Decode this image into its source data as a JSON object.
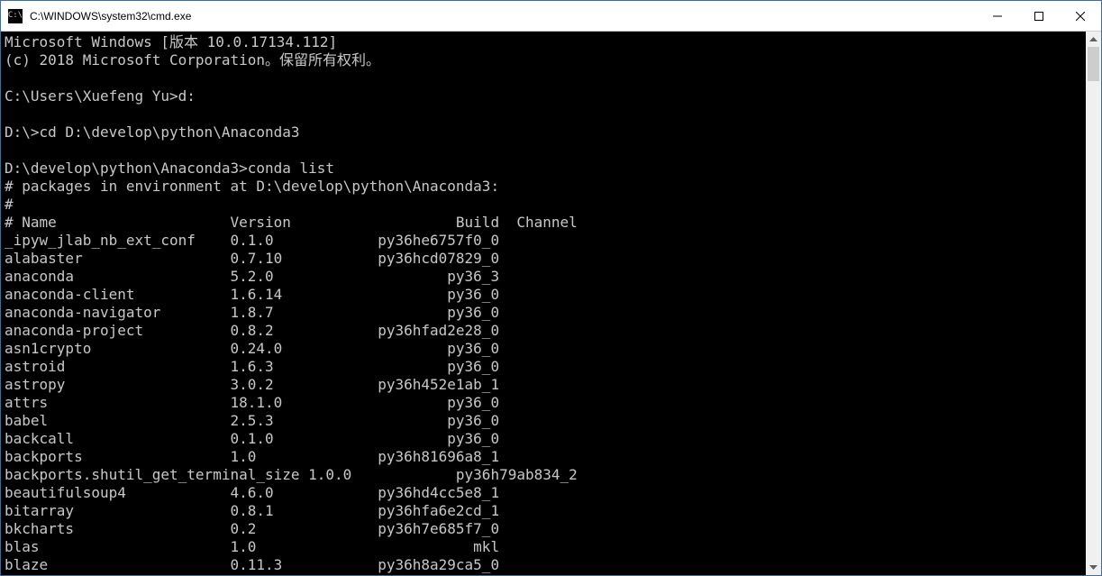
{
  "window": {
    "title": "C:\\WINDOWS\\system32\\cmd.exe"
  },
  "terminal": {
    "line0": "Microsoft Windows [版本 10.0.17134.112]",
    "line1": "(c) 2018 Microsoft Corporation。保留所有权利。",
    "blank": "",
    "prompt1": "C:\\Users\\Xuefeng Yu>d:",
    "prompt2": "D:\\>cd D:\\develop\\python\\Anaconda3",
    "prompt3": "D:\\develop\\python\\Anaconda3>conda list",
    "comment1": "# packages in environment at D:\\develop\\python\\Anaconda3:",
    "comment2": "#",
    "header": "# Name                    Version                   Build  Channel",
    "pkg0": "_ipyw_jlab_nb_ext_conf    0.1.0            py36he6757f0_0",
    "pkg1": "alabaster                 0.7.10           py36hcd07829_0",
    "pkg2": "anaconda                  5.2.0                    py36_3",
    "pkg3": "anaconda-client           1.6.14                   py36_0",
    "pkg4": "anaconda-navigator        1.8.7                    py36_0",
    "pkg5": "anaconda-project          0.8.2            py36hfad2e28_0",
    "pkg6": "asn1crypto                0.24.0                   py36_0",
    "pkg7": "astroid                   1.6.3                    py36_0",
    "pkg8": "astropy                   3.0.2            py36h452e1ab_1",
    "pkg9": "attrs                     18.1.0                   py36_0",
    "pkg10": "babel                     2.5.3                    py36_0",
    "pkg11": "backcall                  0.1.0                    py36_0",
    "pkg12": "backports                 1.0              py36h81696a8_1",
    "pkg13": "backports.shutil_get_terminal_size 1.0.0            py36h79ab834_2",
    "pkg14": "beautifulsoup4            4.6.0            py36hd4cc5e8_1",
    "pkg15": "bitarray                  0.8.1            py36hfa6e2cd_1",
    "pkg16": "bkcharts                  0.2              py36h7e685f7_0",
    "pkg17": "blas                      1.0                         mkl",
    "pkg18": "blaze                     0.11.3           py36h8a29ca5_0"
  }
}
